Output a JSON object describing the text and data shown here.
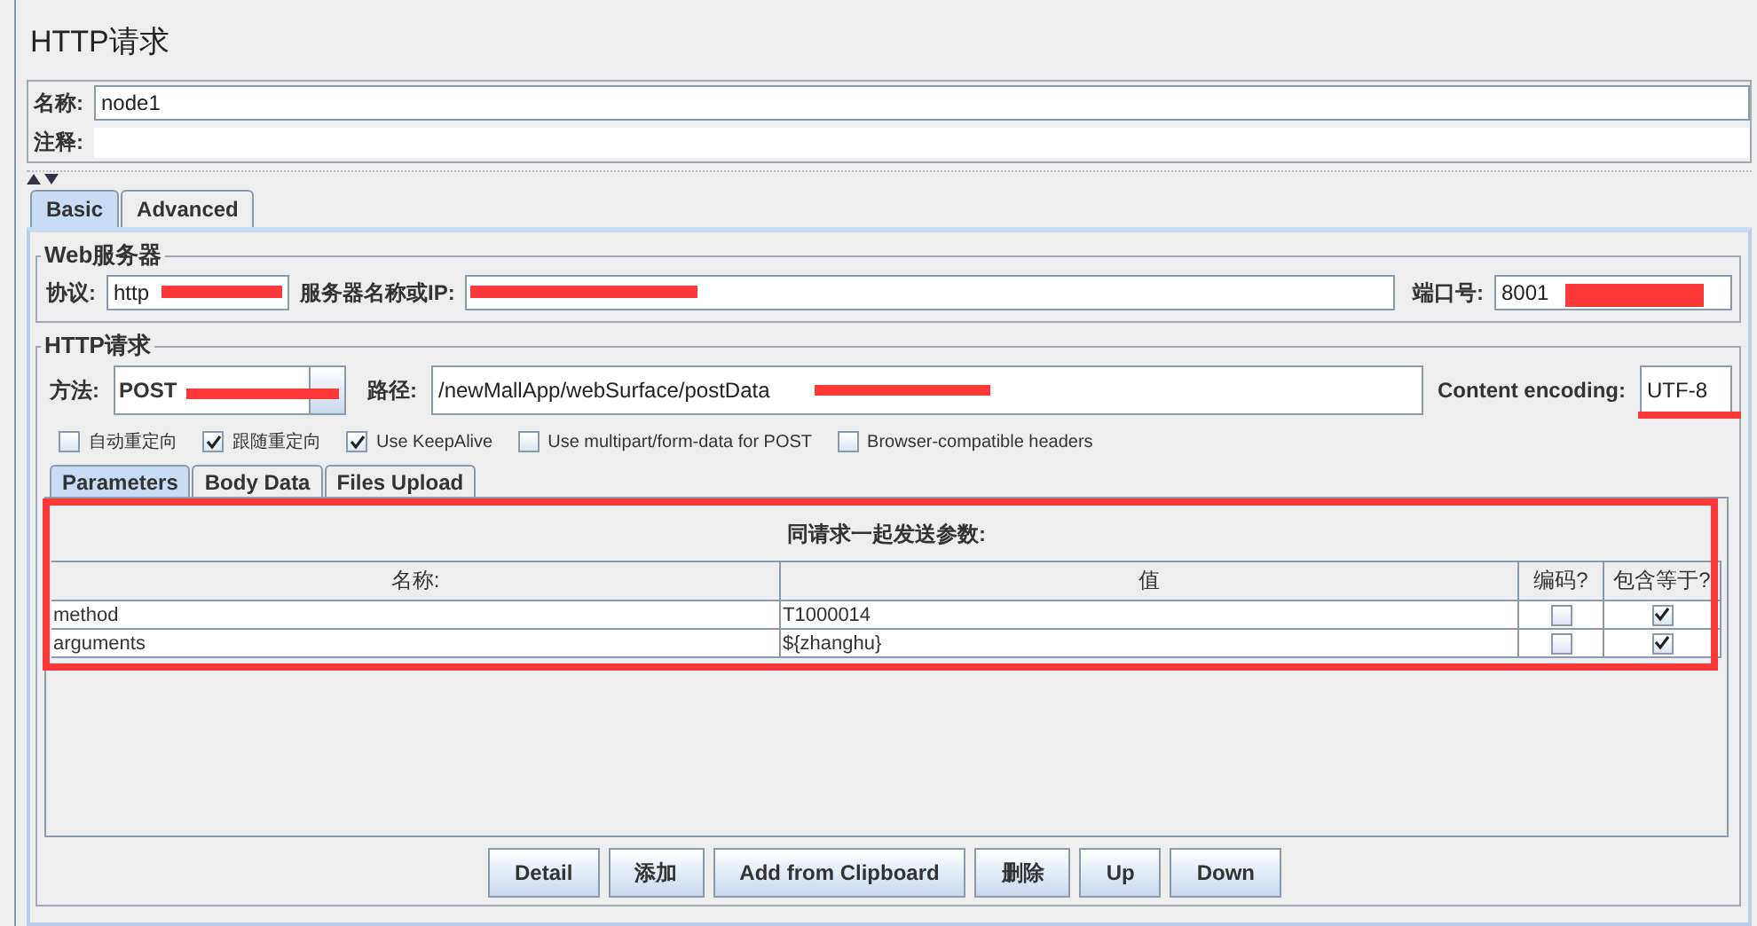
{
  "title": "HTTP请求",
  "name_field": {
    "label": "名称:",
    "value": "node1"
  },
  "comment_field": {
    "label": "注释:"
  },
  "tabs": [
    {
      "label": "Basic",
      "selected": true
    },
    {
      "label": "Advanced",
      "selected": false
    }
  ],
  "web_server": {
    "title": "Web服务器",
    "protocol_label": "协议:",
    "protocol": "http",
    "server_label": "服务器名称或IP:",
    "port_label": "端口号:",
    "port": "8001"
  },
  "http_request": {
    "title": "HTTP请求",
    "method_label": "方法:",
    "method": "POST",
    "path_label": "路径:",
    "path": "/newMallApp/webSurface/postData",
    "encoding_label": "Content encoding:",
    "encoding": "UTF-8"
  },
  "options": [
    {
      "label": "自动重定向",
      "checked": false
    },
    {
      "label": "跟随重定向",
      "checked": true
    },
    {
      "label": "Use KeepAlive",
      "checked": true
    },
    {
      "label": "Use multipart/form-data for POST",
      "checked": false
    },
    {
      "label": "Browser-compatible headers",
      "checked": false
    }
  ],
  "sub_tabs": [
    {
      "label": "Parameters",
      "selected": true
    },
    {
      "label": "Body Data",
      "selected": false
    },
    {
      "label": "Files Upload",
      "selected": false
    }
  ],
  "parameters": {
    "caption": "同请求一起发送参数:",
    "columns": [
      "名称:",
      "值",
      "编码?",
      "包含等于?"
    ],
    "rows": [
      {
        "name": "method",
        "value": "T1000014",
        "encode": false,
        "include_equals": true
      },
      {
        "name": "arguments",
        "value": "${zhanghu}",
        "encode": false,
        "include_equals": true
      }
    ]
  },
  "buttons": [
    "Detail",
    "添加",
    "Add from Clipboard",
    "删除",
    "Up",
    "Down"
  ]
}
